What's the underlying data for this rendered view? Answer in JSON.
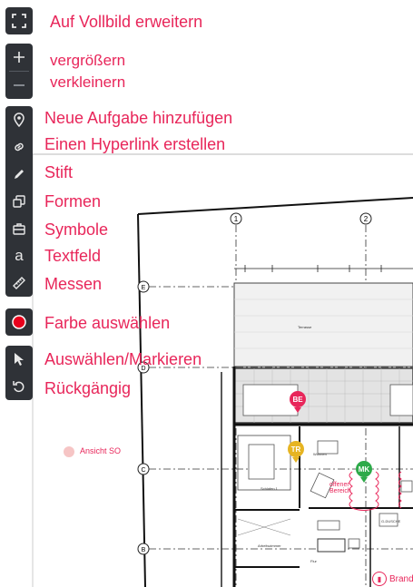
{
  "toolbar": {
    "fullscreen_label": "Auf Vollbild erweitern",
    "zoom_in_label": "vergrößern",
    "zoom_out_label": "verkleinern",
    "new_task_label": "Neue Aufgabe hinzufügen",
    "hyperlink_label": "Einen Hyperlink erstellen",
    "pen_label": "Stift",
    "shapes_label": "Formen",
    "symbols_label": "Symbole",
    "textfield_label": "Textfeld",
    "textfield_glyph": "a",
    "measure_label": "Messen",
    "color_label": "Farbe auswählen",
    "select_label": "Auswählen/Markieren",
    "undo_label": "Rückgängig",
    "active_color": "#e8001c"
  },
  "plan": {
    "axis_labels": [
      "1",
      "2",
      "E",
      "D",
      "C",
      "B"
    ],
    "room_labels": [
      "Terrasse",
      "Wohnen",
      "Schlafen 1",
      "Arbeitszimmer",
      "Flur",
      "G-DUSCHE"
    ],
    "open_area_text": "offener Bereich",
    "annotation_text": "Ansicht SO",
    "brand_text": "Brand"
  },
  "markers": [
    {
      "label": "BE",
      "color": "#e8265a"
    },
    {
      "label": "TR",
      "color": "#e6b422"
    },
    {
      "label": "MK",
      "color": "#2eaa4a"
    }
  ]
}
